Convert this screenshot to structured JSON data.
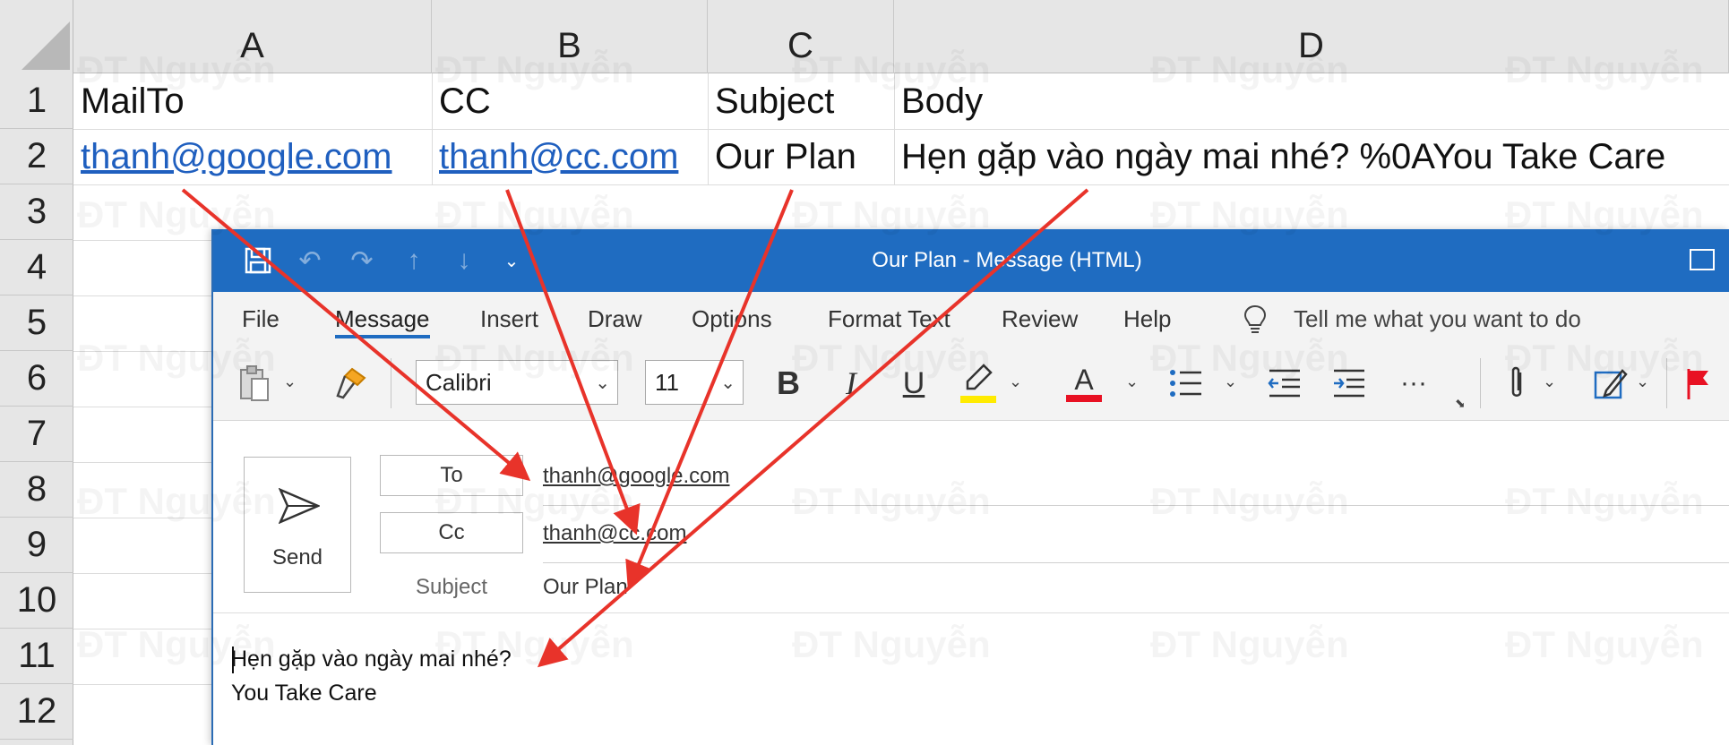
{
  "excel": {
    "columns": [
      "A",
      "B",
      "C",
      "D"
    ],
    "rows": [
      "1",
      "2",
      "3",
      "4",
      "5",
      "6",
      "7",
      "8",
      "9",
      "10",
      "11",
      "12"
    ],
    "header_row": {
      "a": "MailTo",
      "b": "CC",
      "c": "Subject",
      "d": "Body"
    },
    "data_row": {
      "a": "thanh@google.com",
      "b": "thanh@cc.com",
      "c": "Our Plan",
      "d": "Hẹn gặp vào ngày mai nhé? %0AYou Take Care"
    }
  },
  "watermark": "ĐT Nguyễn",
  "outlook": {
    "title": "Our Plan  -  Message (HTML)",
    "quick_access": [
      "save-icon",
      "undo-icon",
      "redo-icon",
      "up-arrow-icon",
      "down-arrow-icon",
      "customize-icon"
    ],
    "menu": [
      "File",
      "Message",
      "Insert",
      "Draw",
      "Options",
      "Format Text",
      "Review",
      "Help"
    ],
    "active_menu": "Message",
    "tell_me": "Tell me what you want to do",
    "ribbon": {
      "font_name": "Calibri",
      "font_size": "11",
      "bold": "B",
      "italic": "I",
      "underline": "U",
      "font_color_glyph": "A",
      "more": "···"
    },
    "send_label": "Send",
    "to_label": "To",
    "cc_label": "Cc",
    "subject_label": "Subject",
    "to_value": "thanh@google.com",
    "cc_value": "thanh@cc.com",
    "subject_value": "Our Plan",
    "body_lines": [
      "Hẹn gặp vào ngày mai nhé?",
      "You Take Care"
    ]
  },
  "colors": {
    "titlebar": "#1f6cc1",
    "link": "#1f5fbf",
    "arrow": "#e8332a",
    "highlight": "#ffeb00",
    "font_color": "#e81123"
  }
}
